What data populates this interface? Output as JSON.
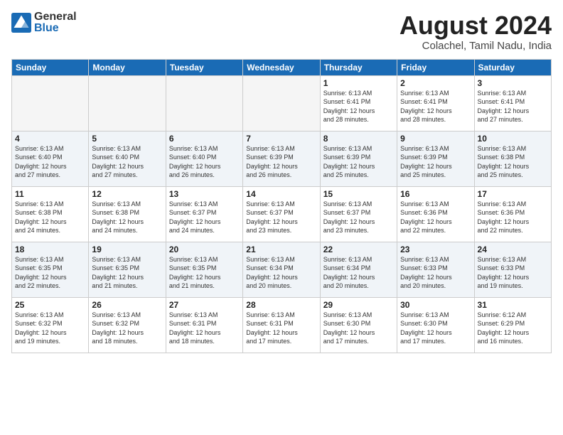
{
  "logo": {
    "general": "General",
    "blue": "Blue"
  },
  "title": "August 2024",
  "location": "Colachel, Tamil Nadu, India",
  "headers": [
    "Sunday",
    "Monday",
    "Tuesday",
    "Wednesday",
    "Thursday",
    "Friday",
    "Saturday"
  ],
  "weeks": [
    [
      {
        "day": "",
        "info": ""
      },
      {
        "day": "",
        "info": ""
      },
      {
        "day": "",
        "info": ""
      },
      {
        "day": "",
        "info": ""
      },
      {
        "day": "1",
        "info": "Sunrise: 6:13 AM\nSunset: 6:41 PM\nDaylight: 12 hours\nand 28 minutes."
      },
      {
        "day": "2",
        "info": "Sunrise: 6:13 AM\nSunset: 6:41 PM\nDaylight: 12 hours\nand 28 minutes."
      },
      {
        "day": "3",
        "info": "Sunrise: 6:13 AM\nSunset: 6:41 PM\nDaylight: 12 hours\nand 27 minutes."
      }
    ],
    [
      {
        "day": "4",
        "info": "Sunrise: 6:13 AM\nSunset: 6:40 PM\nDaylight: 12 hours\nand 27 minutes."
      },
      {
        "day": "5",
        "info": "Sunrise: 6:13 AM\nSunset: 6:40 PM\nDaylight: 12 hours\nand 27 minutes."
      },
      {
        "day": "6",
        "info": "Sunrise: 6:13 AM\nSunset: 6:40 PM\nDaylight: 12 hours\nand 26 minutes."
      },
      {
        "day": "7",
        "info": "Sunrise: 6:13 AM\nSunset: 6:39 PM\nDaylight: 12 hours\nand 26 minutes."
      },
      {
        "day": "8",
        "info": "Sunrise: 6:13 AM\nSunset: 6:39 PM\nDaylight: 12 hours\nand 25 minutes."
      },
      {
        "day": "9",
        "info": "Sunrise: 6:13 AM\nSunset: 6:39 PM\nDaylight: 12 hours\nand 25 minutes."
      },
      {
        "day": "10",
        "info": "Sunrise: 6:13 AM\nSunset: 6:38 PM\nDaylight: 12 hours\nand 25 minutes."
      }
    ],
    [
      {
        "day": "11",
        "info": "Sunrise: 6:13 AM\nSunset: 6:38 PM\nDaylight: 12 hours\nand 24 minutes."
      },
      {
        "day": "12",
        "info": "Sunrise: 6:13 AM\nSunset: 6:38 PM\nDaylight: 12 hours\nand 24 minutes."
      },
      {
        "day": "13",
        "info": "Sunrise: 6:13 AM\nSunset: 6:37 PM\nDaylight: 12 hours\nand 24 minutes."
      },
      {
        "day": "14",
        "info": "Sunrise: 6:13 AM\nSunset: 6:37 PM\nDaylight: 12 hours\nand 23 minutes."
      },
      {
        "day": "15",
        "info": "Sunrise: 6:13 AM\nSunset: 6:37 PM\nDaylight: 12 hours\nand 23 minutes."
      },
      {
        "day": "16",
        "info": "Sunrise: 6:13 AM\nSunset: 6:36 PM\nDaylight: 12 hours\nand 22 minutes."
      },
      {
        "day": "17",
        "info": "Sunrise: 6:13 AM\nSunset: 6:36 PM\nDaylight: 12 hours\nand 22 minutes."
      }
    ],
    [
      {
        "day": "18",
        "info": "Sunrise: 6:13 AM\nSunset: 6:35 PM\nDaylight: 12 hours\nand 22 minutes."
      },
      {
        "day": "19",
        "info": "Sunrise: 6:13 AM\nSunset: 6:35 PM\nDaylight: 12 hours\nand 21 minutes."
      },
      {
        "day": "20",
        "info": "Sunrise: 6:13 AM\nSunset: 6:35 PM\nDaylight: 12 hours\nand 21 minutes."
      },
      {
        "day": "21",
        "info": "Sunrise: 6:13 AM\nSunset: 6:34 PM\nDaylight: 12 hours\nand 20 minutes."
      },
      {
        "day": "22",
        "info": "Sunrise: 6:13 AM\nSunset: 6:34 PM\nDaylight: 12 hours\nand 20 minutes."
      },
      {
        "day": "23",
        "info": "Sunrise: 6:13 AM\nSunset: 6:33 PM\nDaylight: 12 hours\nand 20 minutes."
      },
      {
        "day": "24",
        "info": "Sunrise: 6:13 AM\nSunset: 6:33 PM\nDaylight: 12 hours\nand 19 minutes."
      }
    ],
    [
      {
        "day": "25",
        "info": "Sunrise: 6:13 AM\nSunset: 6:32 PM\nDaylight: 12 hours\nand 19 minutes."
      },
      {
        "day": "26",
        "info": "Sunrise: 6:13 AM\nSunset: 6:32 PM\nDaylight: 12 hours\nand 18 minutes."
      },
      {
        "day": "27",
        "info": "Sunrise: 6:13 AM\nSunset: 6:31 PM\nDaylight: 12 hours\nand 18 minutes."
      },
      {
        "day": "28",
        "info": "Sunrise: 6:13 AM\nSunset: 6:31 PM\nDaylight: 12 hours\nand 17 minutes."
      },
      {
        "day": "29",
        "info": "Sunrise: 6:13 AM\nSunset: 6:30 PM\nDaylight: 12 hours\nand 17 minutes."
      },
      {
        "day": "30",
        "info": "Sunrise: 6:13 AM\nSunset: 6:30 PM\nDaylight: 12 hours\nand 17 minutes."
      },
      {
        "day": "31",
        "info": "Sunrise: 6:12 AM\nSunset: 6:29 PM\nDaylight: 12 hours\nand 16 minutes."
      }
    ]
  ]
}
